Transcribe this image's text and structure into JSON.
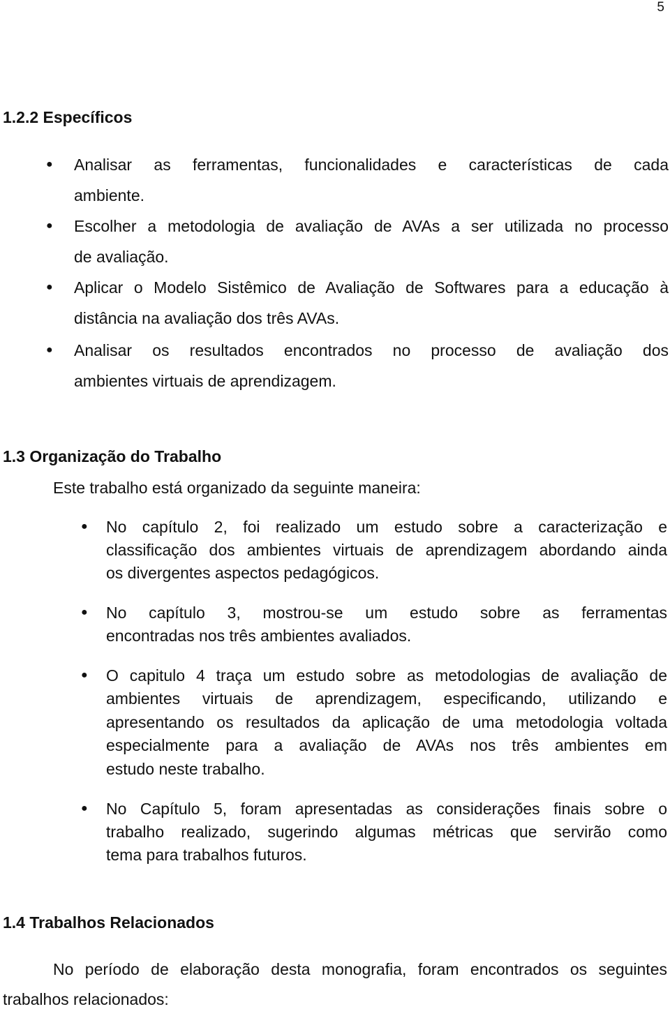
{
  "page_number": "5",
  "sections": [
    {
      "heading": "1.2.2 Específicos",
      "bullets": [
        {
          "lines": [
            "Analisar as ferramentas, funcionalidades e características de cada",
            "ambiente."
          ]
        },
        {
          "lines": [
            "Escolher a metodologia de avaliação de AVAs a ser utilizada no processo",
            "de avaliação."
          ]
        },
        {
          "lines": [
            "Aplicar o Modelo Sistêmico de Avaliação de Softwares para a educação à",
            "distância na avaliação dos três AVAs."
          ]
        },
        {
          "lines": [
            "Analisar os resultados encontrados no processo de avaliação dos",
            "ambientes virtuais de aprendizagem."
          ]
        }
      ]
    },
    {
      "heading": "1.3 Organização do Trabalho",
      "intro": "Este trabalho está organizado da seguinte maneira:",
      "bullets": [
        {
          "lines": [
            "No capítulo 2, foi realizado um estudo sobre a caracterização e",
            "classificação dos ambientes virtuais de aprendizagem abordando ainda",
            "os divergentes aspectos pedagógicos."
          ]
        },
        {
          "lines": [
            "No capítulo 3, mostrou-se um estudo sobre as ferramentas",
            "encontradas nos três ambientes avaliados."
          ]
        },
        {
          "lines": [
            "O capitulo 4 traça um estudo sobre as metodologias de avaliação de",
            "ambientes virtuais de aprendizagem,  especificando, utilizando e",
            "apresentando os resultados da aplicação de uma metodologia voltada",
            "especialmente para a avaliação de AVAs nos três ambientes em",
            "estudo neste trabalho."
          ]
        },
        {
          "lines": [
            "No Capítulo 5, foram apresentadas as considerações finais sobre o",
            "trabalho realizado, sugerindo algumas métricas que servirão como",
            "tema para trabalhos futuros."
          ]
        }
      ]
    },
    {
      "heading": "1.4 Trabalhos Relacionados",
      "paragraph_lines": [
        "No período de elaboração desta monografia, foram encontrados os seguintes",
        "trabalhos relacionados:"
      ]
    }
  ]
}
